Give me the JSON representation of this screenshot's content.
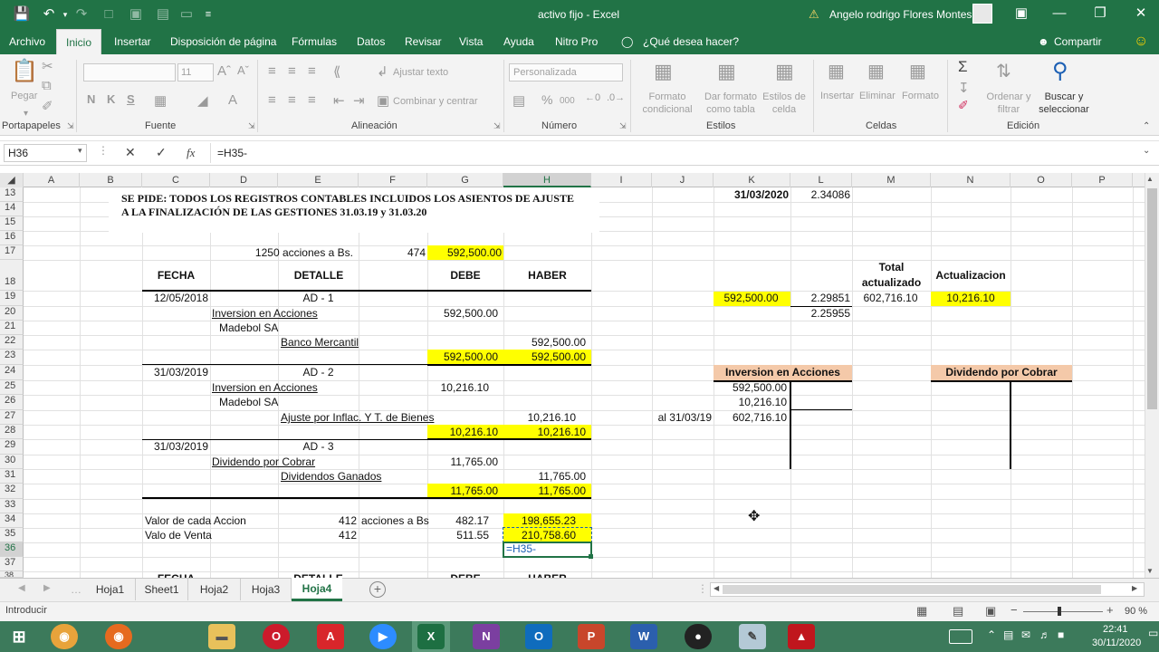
{
  "title_bar": {
    "doc_title": "activo fijo  -  Excel",
    "user_name": "Angelo rodrigo Flores Montes"
  },
  "menu": [
    "Archivo",
    "Inicio",
    "Insertar",
    "Disposición de página",
    "Fórmulas",
    "Datos",
    "Revisar",
    "Vista",
    "Ayuda",
    "Nitro Pro",
    "¿Qué desea hacer?"
  ],
  "share_label": "Compartir",
  "ribbon": {
    "clipboard": {
      "paste": "Pegar",
      "label": "Portapapeles"
    },
    "font": {
      "size": "11",
      "bold": "N",
      "italic": "K",
      "underline": "S",
      "label": "Fuente"
    },
    "alignment": {
      "wrap": "Ajustar texto",
      "merge": "Combinar y centrar",
      "label": "Alineación"
    },
    "number": {
      "format": "Personalizada",
      "pct": "%",
      "thousands": "000",
      "label": "Número"
    },
    "styles": {
      "cond": "Formato condicional",
      "table": "Dar formato como tabla",
      "cell": "Estilos de celda",
      "label": "Estilos"
    },
    "cells": {
      "insert": "Insertar",
      "delete": "Eliminar",
      "format": "Formato",
      "label": "Celdas"
    },
    "editing": {
      "sort": "Ordenar y filtrar",
      "find": "Buscar y seleccionar",
      "label": "Edición"
    }
  },
  "formula_bar": {
    "name_box": "H36",
    "fx": "fx",
    "formula": "=H35-"
  },
  "columns": [
    "A",
    "B",
    "C",
    "D",
    "E",
    "F",
    "G",
    "H",
    "I",
    "J",
    "K",
    "L",
    "M",
    "N",
    "O",
    "P"
  ],
  "rows": [
    "13",
    "14",
    "15",
    "16",
    "17",
    "18",
    "19",
    "20",
    "21",
    "22",
    "23",
    "24",
    "25",
    "26",
    "27",
    "28",
    "29",
    "30",
    "31",
    "32",
    "33",
    "34",
    "35",
    "36",
    "37",
    "38"
  ],
  "cells": {
    "c13": "SE PIDE: TODOS LOS REGISTROS CONTABLES INCLUIDOS LOS ASIENTOS DE AJUSTE",
    "c14": "A LA FINALIZACIÓN DE LAS GESTIONES 31.03.19 y 31.03.20",
    "k13": "31/03/2020",
    "l13": "2.34086",
    "d17": "1250 acciones a Bs.",
    "f17": "474",
    "g17": "592,500.00",
    "fecha": "FECHA",
    "detalle": "DETALLE",
    "debe": "DEBE",
    "haber": "HABER",
    "m18a": "Total",
    "m18b": "actualizado",
    "n18": "Actualizacion",
    "c19": "12/05/2018",
    "e19": "AD - 1",
    "k19": "592,500.00",
    "l19": "2.29851",
    "m19": "602,716.10",
    "n19": "10,216.10",
    "d20": "Inversion en Acciones",
    "g20": "592,500.00",
    "l20": "2.25955",
    "d21": "Madebol SA",
    "e22": "Banco Mercantil",
    "h22": "592,500.00",
    "g23": "592,500.00",
    "h23": "592,500.00",
    "c24": "31/03/2019",
    "e24": "AD - 2",
    "k24": "Inversion en Acciones",
    "n24": "Dividendo por Cobrar",
    "d25": "Inversion en Acciones",
    "g25": "10,216.10",
    "k25": "592,500.00",
    "d26": "Madebol SA",
    "k26": "10,216.10",
    "e27": "Ajuste por Inflac. Y T. de Bienes",
    "h27": "10,216.10",
    "j27": "al 31/03/19",
    "k27": "602,716.10",
    "g28": "10,216.10",
    "h28": "10,216.10",
    "c29": "31/03/2019",
    "e29": "AD - 3",
    "d30": "Dividendo por Cobrar",
    "g30": "11,765.00",
    "e31": "Dividendos Ganados",
    "h31": "11,765.00",
    "g32": "11,765.00",
    "h32": "11,765.00",
    "c34": "Valor de cada Accion",
    "e34": "412",
    "f34": "acciones a Bs",
    "g34": "482.17",
    "h34": "198,655.23",
    "c35": "Valo de Venta",
    "e35": "412",
    "g35": "511.55",
    "h35": "210,758.60",
    "h36": "=H35-"
  },
  "sheets": [
    "Hoja1",
    "Sheet1",
    "Hoja2",
    "Hoja3",
    "Hoja4"
  ],
  "active_sheet": "Hoja4",
  "status": {
    "mode": "Introducir",
    "zoom": "90 %"
  },
  "clock": {
    "time": "22:41",
    "date": "30/11/2020"
  },
  "colors": {
    "excel_green": "#217346",
    "highlight": "#ffff00",
    "salmon": "#f4c9a9"
  }
}
